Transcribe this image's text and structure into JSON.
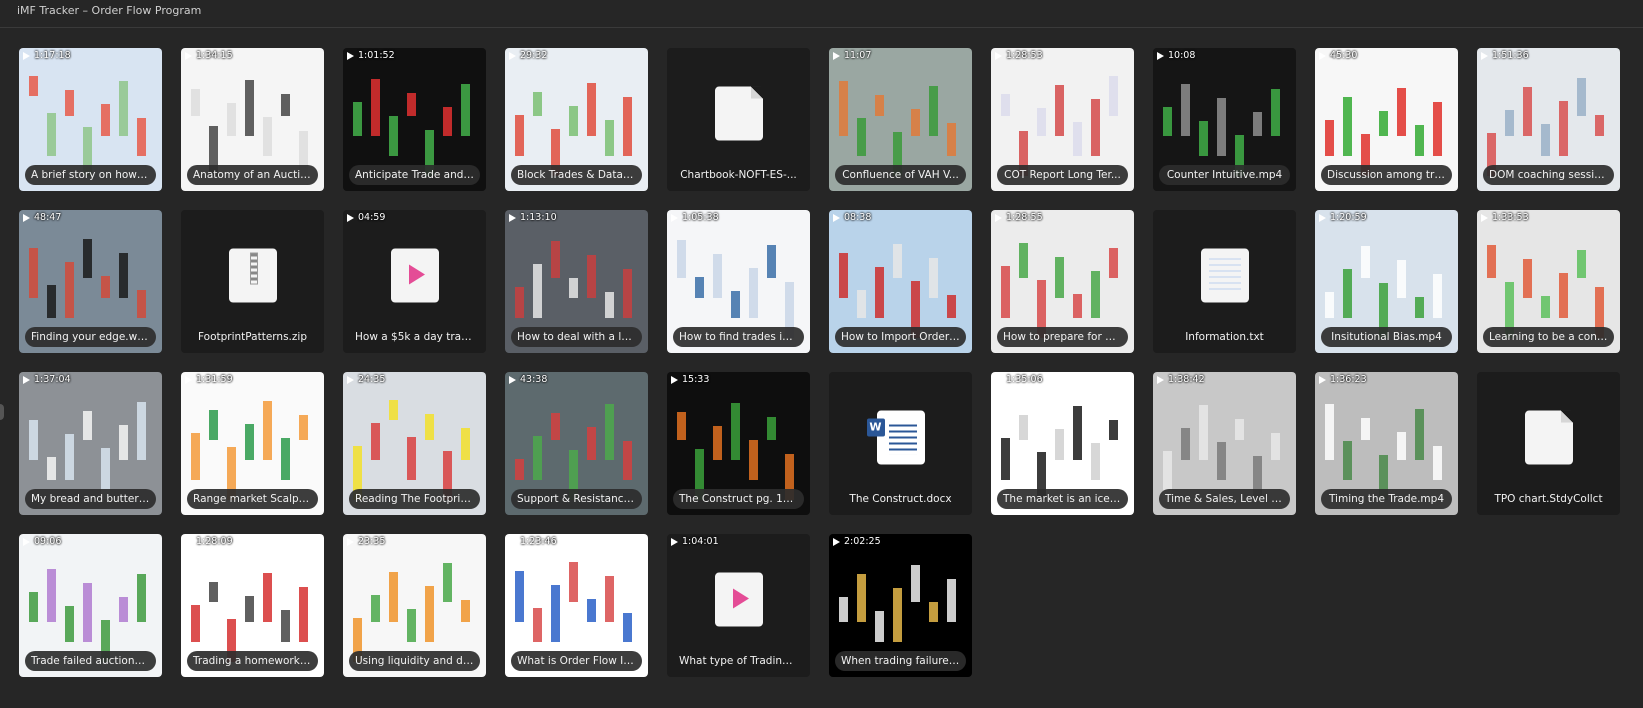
{
  "window": {
    "title": "iMF Tracker – Order Flow Program"
  },
  "items": [
    {
      "kind": "video",
      "duration": "1:17:18",
      "label": "A brief story on how t...",
      "thumb": [
        "#d8e4f2",
        "#e85a4a",
        "#8fc58a"
      ]
    },
    {
      "kind": "video",
      "duration": "1:34:15",
      "label": "Anatomy of an Auctio...",
      "thumb": [
        "#f5f5f5",
        "#dddddd",
        "#444444"
      ]
    },
    {
      "kind": "video",
      "duration": "1:01:52",
      "label": "Anticipate Trade and ...",
      "thumb": [
        "#101010",
        "#43b04a",
        "#e03030"
      ]
    },
    {
      "kind": "video",
      "duration": "29:32",
      "label": "Block Trades & Data r...",
      "thumb": [
        "#e9eef3",
        "#e04c3c",
        "#7bbf72"
      ]
    },
    {
      "kind": "file",
      "icon": "generic-file-icon",
      "label": "Chartbook-NOFT-ES-..."
    },
    {
      "kind": "video",
      "duration": "11:07",
      "label": "Confluence of VAH V...",
      "thumb": [
        "#9aa7a2",
        "#e07a3a",
        "#3a9a3a"
      ]
    },
    {
      "kind": "video",
      "duration": "1:28:53",
      "label": "COT Report Long Ter...",
      "thumb": [
        "#f2f2f2",
        "#dcdcec",
        "#d54a4a"
      ]
    },
    {
      "kind": "video",
      "duration": "10:08",
      "label": "Counter Intuitive.mp4",
      "thumb": [
        "#151515",
        "#3fae47",
        "#8e8e8e"
      ]
    },
    {
      "kind": "video",
      "duration": "45:30",
      "label": "Discussion among tra...",
      "thumb": [
        "#f7f7f7",
        "#e0302a",
        "#33aa33"
      ]
    },
    {
      "kind": "video",
      "duration": "1:51:36",
      "label": "DOM coaching sessio...",
      "thumb": [
        "#e4e8ec",
        "#d85050",
        "#9ab0c8"
      ]
    },
    {
      "kind": "video",
      "duration": "48:47",
      "label": "Finding your edge.wmv",
      "thumb": [
        "#7b8a97",
        "#d24a3a",
        "#1a1a1a"
      ]
    },
    {
      "kind": "file",
      "icon": "zip-file-icon",
      "label": "FootprintPatterns.zip"
    },
    {
      "kind": "file",
      "icon": "media-file-icon",
      "duration": "04:59",
      "label": "How a $5k a day trad..."
    },
    {
      "kind": "video",
      "duration": "1:13:10",
      "label": "How to deal with a lo...",
      "thumb": [
        "#5a5f66",
        "#c84040",
        "#e6e6e6"
      ]
    },
    {
      "kind": "video",
      "duration": "1:05:38",
      "label": "How to find trades in ...",
      "thumb": [
        "#f5f6f8",
        "#c9d6e8",
        "#3a6ea8"
      ]
    },
    {
      "kind": "video",
      "duration": "08:38",
      "label": "How to Import Order ...",
      "thumb": [
        "#b9d3ea",
        "#cc2e2e",
        "#e6e6e6"
      ]
    },
    {
      "kind": "video",
      "duration": "1:28:55",
      "label": "How to prepare for a ...",
      "thumb": [
        "#ececec",
        "#d84a4a",
        "#49a849"
      ]
    },
    {
      "kind": "file",
      "icon": "text-file-icon",
      "label": "Information.txt"
    },
    {
      "kind": "video",
      "duration": "1:20:59",
      "label": "Insitutional Bias.mp4",
      "thumb": [
        "#d8e2ec",
        "#ffffff",
        "#3ca13c"
      ]
    },
    {
      "kind": "video",
      "duration": "1:33:53",
      "label": "Learning to be a contr...",
      "thumb": [
        "#e6e6e6",
        "#e05a3a",
        "#5cbf5c"
      ]
    },
    {
      "kind": "video",
      "duration": "1:37:04",
      "label": "My bread and butter t...",
      "thumb": [
        "#8d9196",
        "#d7e3ef",
        "#f5f5f5"
      ]
    },
    {
      "kind": "video",
      "duration": "1:31:59",
      "label": "Range market Scalpin...",
      "thumb": [
        "#fafafa",
        "#f39a3a",
        "#2a9a4a"
      ]
    },
    {
      "kind": "video",
      "duration": "24:35",
      "label": "Reading The Footprin...",
      "thumb": [
        "#d9dde2",
        "#f2e02a",
        "#d84040"
      ]
    },
    {
      "kind": "video",
      "duration": "43:38",
      "label": "Support & Resistance....",
      "thumb": [
        "#5d6a6e",
        "#d44040",
        "#4ca84c"
      ]
    },
    {
      "kind": "video",
      "duration": "15:33",
      "label": "The Construct pg. 19 ...",
      "thumb": [
        "#0e0e0e",
        "#e07020",
        "#3aa03a"
      ]
    },
    {
      "kind": "file",
      "icon": "word-file-icon",
      "label": "The Construct.docx"
    },
    {
      "kind": "video",
      "duration": "1:35:06",
      "label": "The market is an ice b...",
      "thumb": [
        "#ffffff",
        "#1a1a1a",
        "#d0d0d0"
      ]
    },
    {
      "kind": "video",
      "duration": "1:38:42",
      "label": "Time & Sales, Level II ...",
      "thumb": [
        "#c8c8c8",
        "#e8e8e8",
        "#7a7a7a"
      ]
    },
    {
      "kind": "video",
      "duration": "1:36:23",
      "label": "Timing the Trade.mp4",
      "thumb": [
        "#bdbdbd",
        "#ffffff",
        "#4a8a4a"
      ]
    },
    {
      "kind": "file",
      "icon": "generic-file-icon",
      "label": "TPO chart.StdyCollct"
    },
    {
      "kind": "video",
      "duration": "09:06",
      "label": "Trade failed auctions....",
      "thumb": [
        "#f2f4f6",
        "#3e9a3e",
        "#b07ad0"
      ]
    },
    {
      "kind": "video",
      "duration": "1:28:09",
      "label": "Trading a homework l...",
      "thumb": [
        "#ffffff",
        "#d63030",
        "#444444"
      ]
    },
    {
      "kind": "video",
      "duration": "23:35",
      "label": "Using liquidity and de...",
      "thumb": [
        "#f7f7f7",
        "#f0942a",
        "#49a849"
      ]
    },
    {
      "kind": "video",
      "duration": "1:23:46",
      "label": "What is Order Flow In...",
      "thumb": [
        "#ffffff",
        "#2a60c8",
        "#d84a4a"
      ]
    },
    {
      "kind": "file",
      "icon": "media-file-icon",
      "duration": "1:04:01",
      "label": "What type of Trading ..."
    },
    {
      "kind": "video",
      "duration": "2:02:25",
      "label": "When trading failures...",
      "thumb": [
        "#000000",
        "#f0f0f0",
        "#e6b84a"
      ]
    }
  ]
}
